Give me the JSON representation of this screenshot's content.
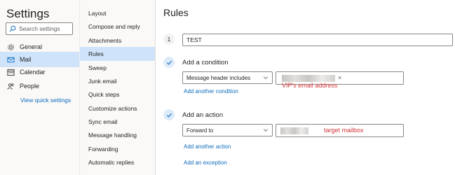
{
  "left_nav": {
    "title": "Settings",
    "search_placeholder": "Search settings",
    "items": [
      {
        "label": "General",
        "icon": "gear-icon"
      },
      {
        "label": "Mail",
        "icon": "mail-icon",
        "active": true
      },
      {
        "label": "Calendar",
        "icon": "calendar-icon"
      },
      {
        "label": "People",
        "icon": "people-icon"
      }
    ],
    "view_quick_settings": "View quick settings"
  },
  "mail_nav": {
    "items": [
      {
        "label": "Layout"
      },
      {
        "label": "Compose and reply"
      },
      {
        "label": "Attachments"
      },
      {
        "label": "Rules",
        "active": true
      },
      {
        "label": "Sweep"
      },
      {
        "label": "Junk email"
      },
      {
        "label": "Quick steps"
      },
      {
        "label": "Customize actions"
      },
      {
        "label": "Sync email"
      },
      {
        "label": "Message handling"
      },
      {
        "label": "Forwarding"
      },
      {
        "label": "Automatic replies"
      }
    ]
  },
  "rules": {
    "title": "Rules",
    "step_number": "1",
    "rule_name": "TEST",
    "condition_heading": "Add a condition",
    "condition_select": "Message header includes",
    "condition_remove": "×",
    "condition_annotation": "VIP's email address",
    "add_condition_link": "Add another condition",
    "action_heading": "Add an action",
    "action_select": "Forward to",
    "action_annotation": "target mailbox",
    "add_action_link": "Add another action",
    "add_exception_link": "Add an exception"
  },
  "colors": {
    "accent": "#0f6cbd",
    "selected_bg": "#cfe4fa",
    "annotation_red": "#d13438"
  }
}
